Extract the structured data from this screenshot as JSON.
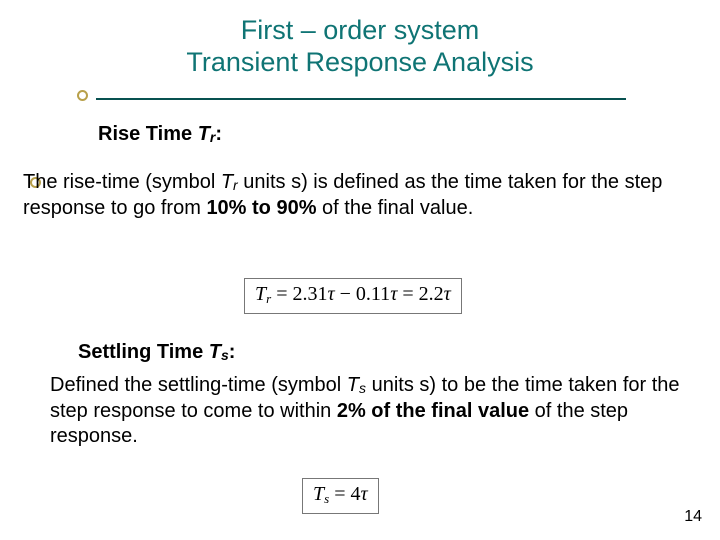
{
  "title": {
    "line1": "First – order system",
    "line2": "Transient Response Analysis"
  },
  "rise": {
    "head_prefix": "Rise Time ",
    "head_symbol": "T",
    "head_sub": "r",
    "head_suffix": ":",
    "body_p1": "The rise-time (symbol ",
    "body_sym": "T",
    "body_sub": "r",
    "body_p2": " units s) is defined as the time taken for the step response to go from ",
    "body_bold": "10% to 90%",
    "body_p3": " of the final value."
  },
  "eq1": {
    "lhs_sym": "T",
    "lhs_sub": "r",
    "eq": " = ",
    "t1": "2.31",
    "tau": "τ",
    "minus": " − ",
    "t2": "0.11",
    "eq2": " = ",
    "t3": "2.2"
  },
  "settle": {
    "head_prefix": "Settling Time ",
    "head_symbol": "T",
    "head_sub": "s",
    "head_suffix": ":",
    "body_p1": "Defined the settling-time (symbol ",
    "body_sym": "T",
    "body_sub": "s",
    "body_p2": " units s) to be the time taken for the step response to come to within ",
    "body_bold": "2% of the final value",
    "body_p3": " of the step response."
  },
  "eq2": {
    "lhs_sym": "T",
    "lhs_sub": "s",
    "eq": " = ",
    "coef": "4",
    "tau": "τ"
  },
  "page_num": "14"
}
